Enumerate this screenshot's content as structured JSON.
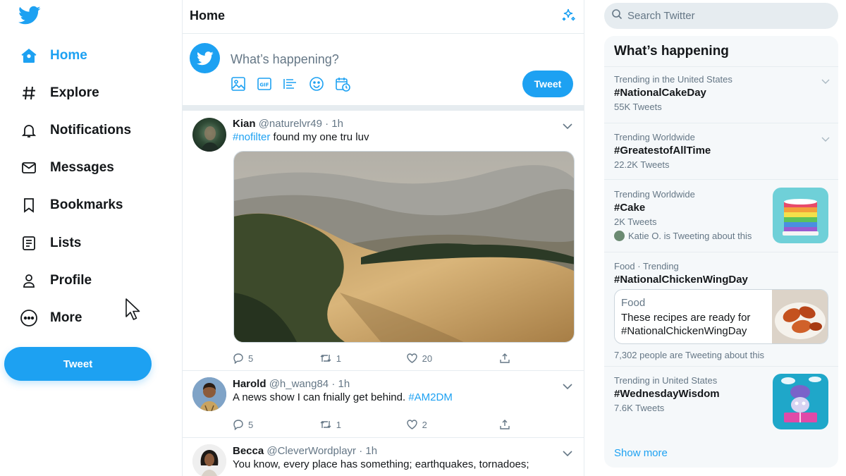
{
  "nav": {
    "items": [
      {
        "label": "Home",
        "icon": "home-icon",
        "active": true
      },
      {
        "label": "Explore",
        "icon": "hash-icon"
      },
      {
        "label": "Notifications",
        "icon": "bell-icon"
      },
      {
        "label": "Messages",
        "icon": "envelope-icon"
      },
      {
        "label": "Bookmarks",
        "icon": "bookmark-icon"
      },
      {
        "label": "Lists",
        "icon": "list-icon"
      },
      {
        "label": "Profile",
        "icon": "person-icon"
      },
      {
        "label": "More",
        "icon": "more-icon"
      }
    ],
    "tweet_button": "Tweet"
  },
  "home": {
    "title": "Home",
    "compose": {
      "placeholder": "What’s happening?",
      "tools": [
        "image-icon",
        "gif-icon",
        "poll-icon",
        "emoji-icon",
        "schedule-icon"
      ],
      "tweet_button": "Tweet"
    }
  },
  "tweets": [
    {
      "name": "Kian",
      "handle": "@naturelvr49",
      "time": "· 1h",
      "hashtag": "#nofilter",
      "text": " found my one tru luv",
      "replies": "5",
      "retweets": "1",
      "likes": "20"
    },
    {
      "name": "Harold",
      "handle": "@h_wang84",
      "time": "· 1h",
      "text": "A news show I can fnially get behind. ",
      "hashtag": "#AM2DM",
      "replies": "5",
      "retweets": "1",
      "likes": "2"
    },
    {
      "name": "Becca",
      "handle": "@CleverWordplayr",
      "time": "· 1h",
      "text": "You know, every place has something; earthquakes, tornadoes;"
    }
  ],
  "search": {
    "placeholder": "Search Twitter"
  },
  "trends": {
    "title": "What’s happening",
    "items": [
      {
        "context": "Trending in the United States",
        "tag": "#NationalCakeDay",
        "count": "55K Tweets"
      },
      {
        "context": "Trending Worldwide",
        "tag": "#GreatestofAllTime",
        "count": "22.2K Tweets"
      },
      {
        "context": "Trending Worldwide",
        "tag": "#Cake",
        "count": "2K Tweets",
        "extra": "Katie O. is Tweeting about this"
      },
      {
        "context": "Food · Trending",
        "tag": "#NationalChickenWingDay",
        "card_label": "Food",
        "card_desc": "These recipes are ready for #NationalChickenWingDay",
        "count": "7,302 people are Tweeting about this"
      },
      {
        "context": "Trending in United States",
        "tag": "#WednesdayWisdom",
        "count": "7.6K Tweets"
      }
    ],
    "show_more": "Show more"
  },
  "colors": {
    "accent": "#1da1f2",
    "text": "#14171a",
    "muted": "#657786",
    "border": "#e6ecf0",
    "panel": "#f5f8fa"
  }
}
